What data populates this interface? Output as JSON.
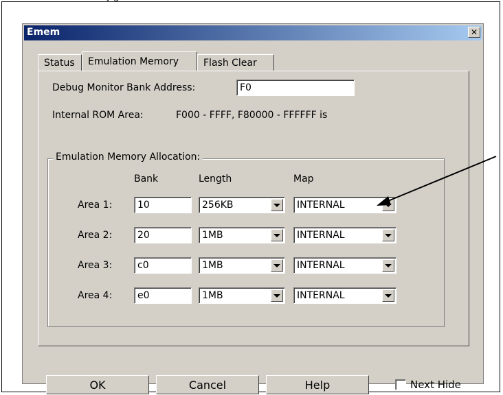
{
  "header_text": "y                                    g",
  "window": {
    "title": "Emem",
    "close_glyph": "✕"
  },
  "tabs": [
    {
      "label": "Status"
    },
    {
      "label": "Emulation Memory"
    },
    {
      "label": "Flash Clear"
    }
  ],
  "fields": {
    "debug_monitor_label": "Debug Monitor Bank Address:",
    "debug_monitor_value": "F0",
    "internal_rom_label": "Internal ROM Area:",
    "internal_rom_value": "F000 - FFFF, F80000 - FFFFFF is"
  },
  "allocation": {
    "group_title": "Emulation Memory Allocation:",
    "headers": {
      "bank": "Bank",
      "length": "Length",
      "map": "Map"
    },
    "rows": [
      {
        "area": "Area 1:",
        "bank": "10",
        "length": "256KB",
        "map": "INTERNAL"
      },
      {
        "area": "Area 2:",
        "bank": "20",
        "length": "1MB",
        "map": "INTERNAL"
      },
      {
        "area": "Area 3:",
        "bank": "c0",
        "length": "1MB",
        "map": "INTERNAL"
      },
      {
        "area": "Area 4:",
        "bank": "e0",
        "length": "1MB",
        "map": "INTERNAL"
      }
    ]
  },
  "buttons": {
    "ok": "OK",
    "cancel": "Cancel",
    "help": "Help"
  },
  "next_hide_label": "Next Hide",
  "colors": {
    "dialog_face": "#d4d0c8",
    "title_start": "#0a246a",
    "title_end": "#a6caf0"
  }
}
